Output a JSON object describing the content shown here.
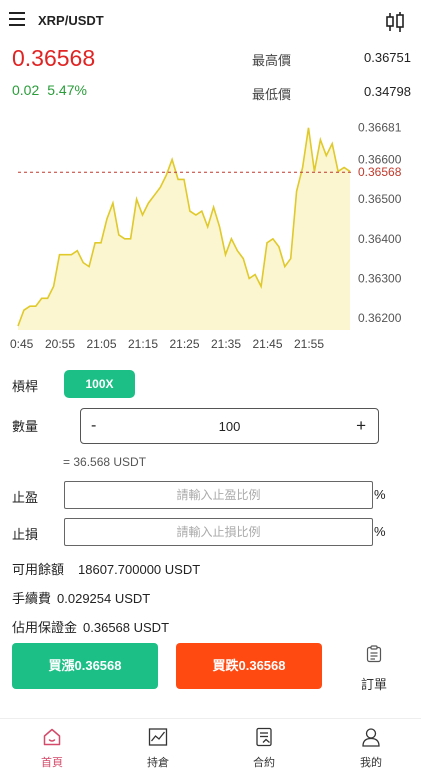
{
  "header": {
    "title": "XRP/USDT",
    "menu_icon": "hamburger-menu-icon",
    "chart_icon": "candlestick-icon"
  },
  "ticker": {
    "price": "0.36568",
    "change": "0.02",
    "change_pct": "5.47%",
    "high_label": "最高價",
    "high_value": "0.36751",
    "low_label": "最低價",
    "low_value": "0.34798",
    "price_color": "#e02424",
    "change_color": "#2a9d3a"
  },
  "chart_data": {
    "type": "area",
    "x_ticks": [
      "0:45",
      "20:55",
      "21:05",
      "21:15",
      "21:25",
      "21:35",
      "21:45",
      "21:55"
    ],
    "y_ticks": [
      "0.36681",
      "0.36600",
      "0.36500",
      "0.36400",
      "0.36300",
      "0.36200"
    ],
    "current_price_label": "0.36568",
    "line_color": "#e0c92a",
    "fill_color": "#fbf6cf",
    "reference_line_color": "#c0392b",
    "ylim": [
      0.3617,
      0.3673
    ],
    "series": [
      {
        "values": [
          0.3618,
          0.3622,
          0.3623,
          0.3623,
          0.3625,
          0.3625,
          0.3628,
          0.3636,
          0.3636,
          0.3636,
          0.3637,
          0.3634,
          0.3633,
          0.3639,
          0.3639,
          0.3645,
          0.3649,
          0.3641,
          0.364,
          0.364,
          0.365,
          0.3646,
          0.3649,
          0.3651,
          0.3653,
          0.3656,
          0.366,
          0.3655,
          0.3655,
          0.3647,
          0.3646,
          0.3647,
          0.3643,
          0.3648,
          0.3643,
          0.3636,
          0.364,
          0.3637,
          0.3635,
          0.363,
          0.3631,
          0.3628,
          0.3639,
          0.364,
          0.3638,
          0.3633,
          0.3635,
          0.3652,
          0.3658,
          0.3668,
          0.3657,
          0.3665,
          0.3661,
          0.3664,
          0.3657,
          0.3658,
          0.3657
        ]
      }
    ]
  },
  "form": {
    "leverage_label": "槓桿",
    "leverage_value": "100X",
    "quantity_label": "數量",
    "quantity_minus": "-",
    "quantity_value": "100",
    "quantity_plus": "+",
    "equivalent": "= 36.568 USDT",
    "take_profit_label": "止盈",
    "take_profit_placeholder": "請輸入止盈比例",
    "stop_loss_label": "止損",
    "stop_loss_placeholder": "請輸入止損比例",
    "percent_sign": "%"
  },
  "account": {
    "available_label": "可用餘額",
    "available_value": "18607.700000 USDT",
    "fee_label": "手續費",
    "fee_value": "0.029254 USDT",
    "margin_label": "佔用保證金",
    "margin_value": "0.36568 USDT"
  },
  "actions": {
    "buy_label": "買漲0.36568",
    "sell_label": "買跌0.36568",
    "orders_label": "訂單",
    "buy_color": "#1cbf86",
    "sell_color": "#ff4a12"
  },
  "nav": {
    "items": [
      {
        "label": "首頁",
        "icon": "home-icon",
        "active": true
      },
      {
        "label": "持倉",
        "icon": "chart-trend-icon",
        "active": false
      },
      {
        "label": "合約",
        "icon": "contract-document-icon",
        "active": false
      },
      {
        "label": "我的",
        "icon": "user-icon",
        "active": false
      }
    ],
    "active_color": "#d44a6a"
  }
}
